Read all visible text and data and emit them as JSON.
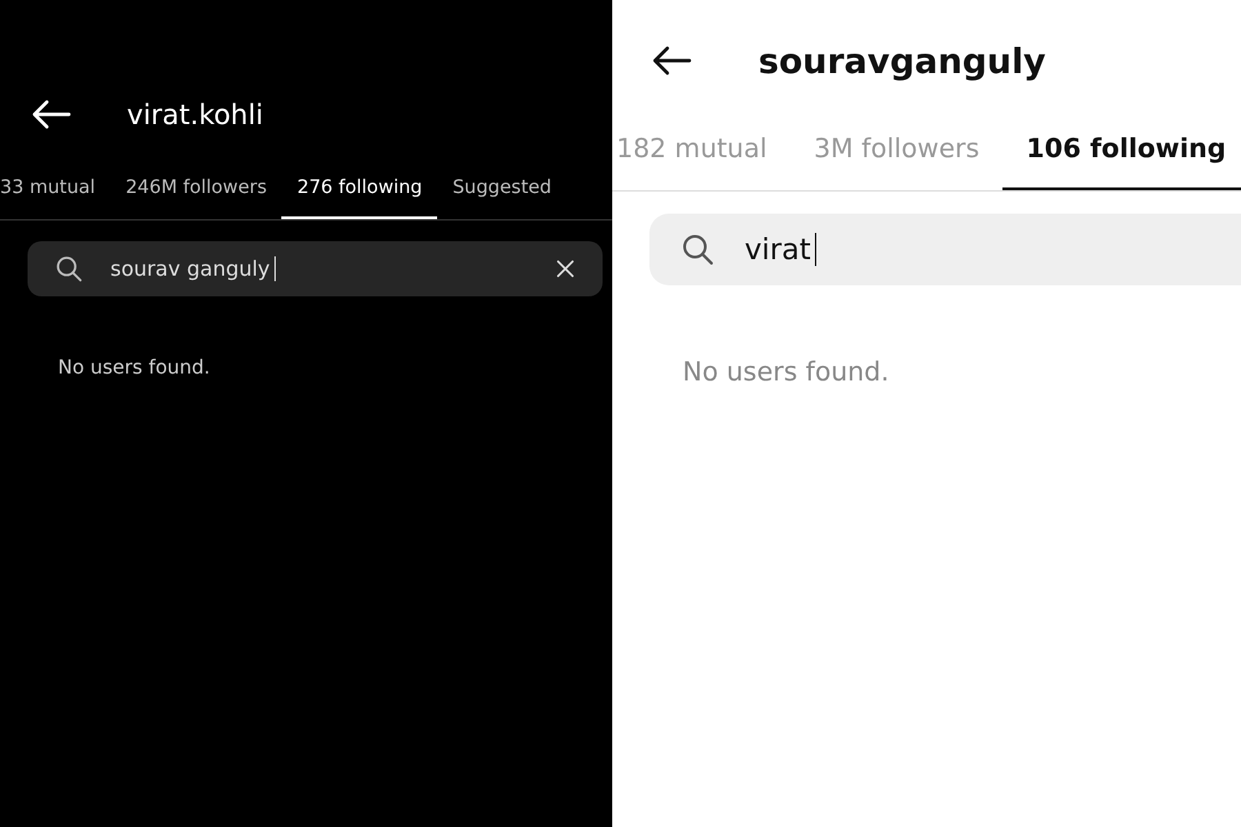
{
  "panels": [
    {
      "kind": "dark",
      "title": "virat.kohli",
      "tabs": [
        {
          "label": "33 mutual",
          "selected": false
        },
        {
          "label": "246M followers",
          "selected": false
        },
        {
          "label": "276 following",
          "selected": true
        },
        {
          "label": "Suggested",
          "selected": false
        }
      ],
      "search": {
        "value": "sourav ganguly",
        "clear_button": true
      },
      "message": "No users found."
    },
    {
      "kind": "light",
      "title": "souravganguly",
      "tabs": [
        {
          "label": "182 mutual",
          "selected": false
        },
        {
          "label": "3M followers",
          "selected": false
        },
        {
          "label": "106 following",
          "selected": true
        }
      ],
      "search": {
        "value": "virat"
      },
      "message": "No users found."
    }
  ]
}
